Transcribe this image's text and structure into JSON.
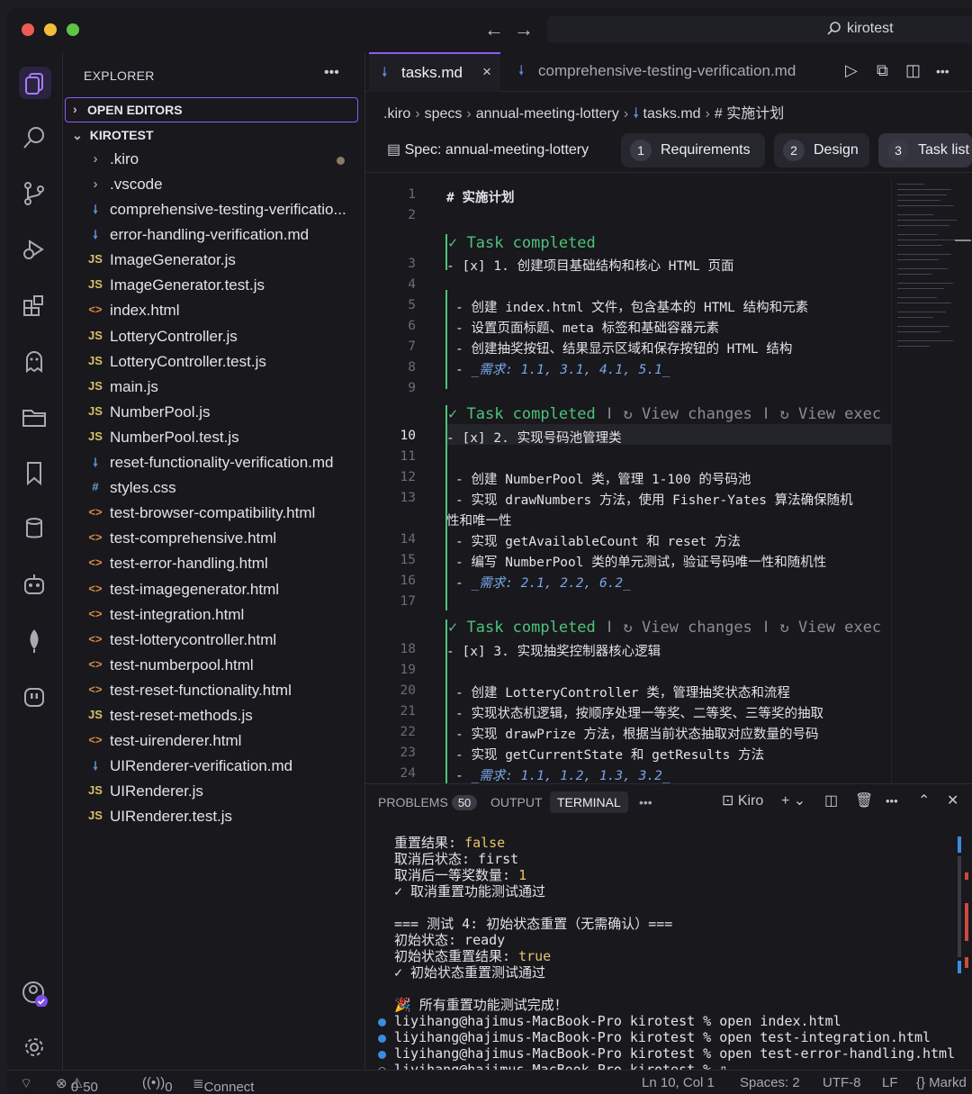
{
  "colors": {
    "accent": "#8b5cf6",
    "completed": "#4fc27a",
    "requirement": "#7aa7e8",
    "term_value": "#e8c46a"
  },
  "titlebar": {
    "search_text": "kirotest"
  },
  "explorer": {
    "title": "EXPLORER",
    "open_editors": "OPEN EDITORS",
    "root": "KIROTEST",
    "folders": [
      ".kiro",
      ".vscode"
    ],
    "files": [
      {
        "name": "comprehensive-testing-verificatio...",
        "type": "md"
      },
      {
        "name": "error-handling-verification.md",
        "type": "md"
      },
      {
        "name": "ImageGenerator.js",
        "type": "js"
      },
      {
        "name": "ImageGenerator.test.js",
        "type": "js"
      },
      {
        "name": "index.html",
        "type": "html"
      },
      {
        "name": "LotteryController.js",
        "type": "js"
      },
      {
        "name": "LotteryController.test.js",
        "type": "js"
      },
      {
        "name": "main.js",
        "type": "js"
      },
      {
        "name": "NumberPool.js",
        "type": "js"
      },
      {
        "name": "NumberPool.test.js",
        "type": "js"
      },
      {
        "name": "reset-functionality-verification.md",
        "type": "md"
      },
      {
        "name": "styles.css",
        "type": "css"
      },
      {
        "name": "test-browser-compatibility.html",
        "type": "html"
      },
      {
        "name": "test-comprehensive.html",
        "type": "html"
      },
      {
        "name": "test-error-handling.html",
        "type": "html"
      },
      {
        "name": "test-imagegenerator.html",
        "type": "html"
      },
      {
        "name": "test-integration.html",
        "type": "html"
      },
      {
        "name": "test-lotterycontroller.html",
        "type": "html"
      },
      {
        "name": "test-numberpool.html",
        "type": "html"
      },
      {
        "name": "test-reset-functionality.html",
        "type": "html"
      },
      {
        "name": "test-reset-methods.js",
        "type": "js"
      },
      {
        "name": "test-uirenderer.html",
        "type": "html"
      },
      {
        "name": "UIRenderer-verification.md",
        "type": "md"
      },
      {
        "name": "UIRenderer.js",
        "type": "js"
      },
      {
        "name": "UIRenderer.test.js",
        "type": "js"
      }
    ]
  },
  "editor": {
    "tabs": [
      {
        "label": "tasks.md"
      },
      {
        "label": "comprehensive-testing-verification.md"
      }
    ],
    "breadcrumb": [
      ".kiro",
      "specs",
      "annual-meeting-lottery",
      "tasks.md",
      "# 实施计划"
    ],
    "spec_label": "Spec: annual-meeting-lottery",
    "spec_tabs": [
      {
        "n": "1",
        "label": "Requirements"
      },
      {
        "n": "2",
        "label": "Design"
      },
      {
        "n": "3",
        "label": "Task list"
      }
    ],
    "task_completed": "Task completed",
    "view_changes": "View changes",
    "view_exec": "View exec",
    "lines": {
      "l1": "# 实施计划",
      "l3": "- [x] 1. 创建项目基础结构和核心 HTML 页面",
      "l5": "- 创建 index.html 文件，包含基本的 HTML 结构和元素",
      "l6": "- 设置页面标题、meta 标签和基础容器元素",
      "l7": "- 创建抽奖按钮、结果显示区域和保存按钮的 HTML 结构",
      "l8a": "- ",
      "l8b": "_需求: 1.1, 3.1, 4.1, 5.1_",
      "l10": "- [x] 2. 实现号码池管理类",
      "l12": "- 创建 NumberPool 类，管理 1-100 的号码池",
      "l13a": "- 实现 drawNumbers 方法，使用 Fisher-Yates 算法确保随机",
      "l13b": "性和唯一性",
      "l14": "- 实现 getAvailableCount 和 reset 方法",
      "l15": "- 编写 NumberPool 类的单元测试，验证号码唯一性和随机性",
      "l16a": "- ",
      "l16b": "_需求: 2.1, 2.2, 6.2_",
      "l18": "- [x] 3. 实现抽奖控制器核心逻辑",
      "l20": "- 创建 LotteryController 类，管理抽奖状态和流程",
      "l21": "- 实现状态机逻辑，按顺序处理一等奖、二等奖、三等奖的抽取",
      "l22": "- 实现 drawPrize 方法，根据当前状态抽取对应数量的号码",
      "l23": "- 实现 getCurrentState 和 getResults 方法",
      "l24a": "- ",
      "l24b": "_需求: 1.1, 1.2, 1.3, 3.2_"
    }
  },
  "panel": {
    "tabs": {
      "problems": "PROBLEMS",
      "problems_count": "50",
      "output": "OUTPUT",
      "terminal": "TERMINAL"
    },
    "shell": "Kiro",
    "terminal": [
      {
        "k": "重置结果: ",
        "v": "false"
      },
      {
        "k": "取消后状态: first",
        "v": ""
      },
      {
        "k": "取消后一等奖数量: ",
        "v": "1"
      },
      {
        "k": "✓ 取消重置功能测试通过",
        "v": ""
      },
      {
        "k": "",
        "v": ""
      },
      {
        "k": "=== 测试 4: 初始状态重置（无需确认）===",
        "v": ""
      },
      {
        "k": "初始状态: ready",
        "v": ""
      },
      {
        "k": "初始状态重置结果: ",
        "v": "true"
      },
      {
        "k": "✓ 初始状态重置测试通过",
        "v": ""
      },
      {
        "k": "",
        "v": ""
      },
      {
        "k": "🎉 所有重置功能测试完成！",
        "v": ""
      },
      {
        "k": "liyihang@hajimus-MacBook-Pro kirotest % open index.html",
        "v": ""
      },
      {
        "k": "liyihang@hajimus-MacBook-Pro kirotest % open test-integration.html",
        "v": ""
      },
      {
        "k": "liyihang@hajimus-MacBook-Pro kirotest % open test-error-handling.html",
        "v": ""
      },
      {
        "k": "liyihang@hajimus-MacBook-Pro kirotest % ▯",
        "v": ""
      }
    ]
  },
  "statusbar": {
    "errors": "0",
    "warnings": "50",
    "ports": "0",
    "connect": "Connect",
    "position": "Ln 10, Col 1",
    "spaces": "Spaces: 2",
    "encoding": "UTF-8",
    "eol": "LF",
    "lang": "{} Markd"
  }
}
